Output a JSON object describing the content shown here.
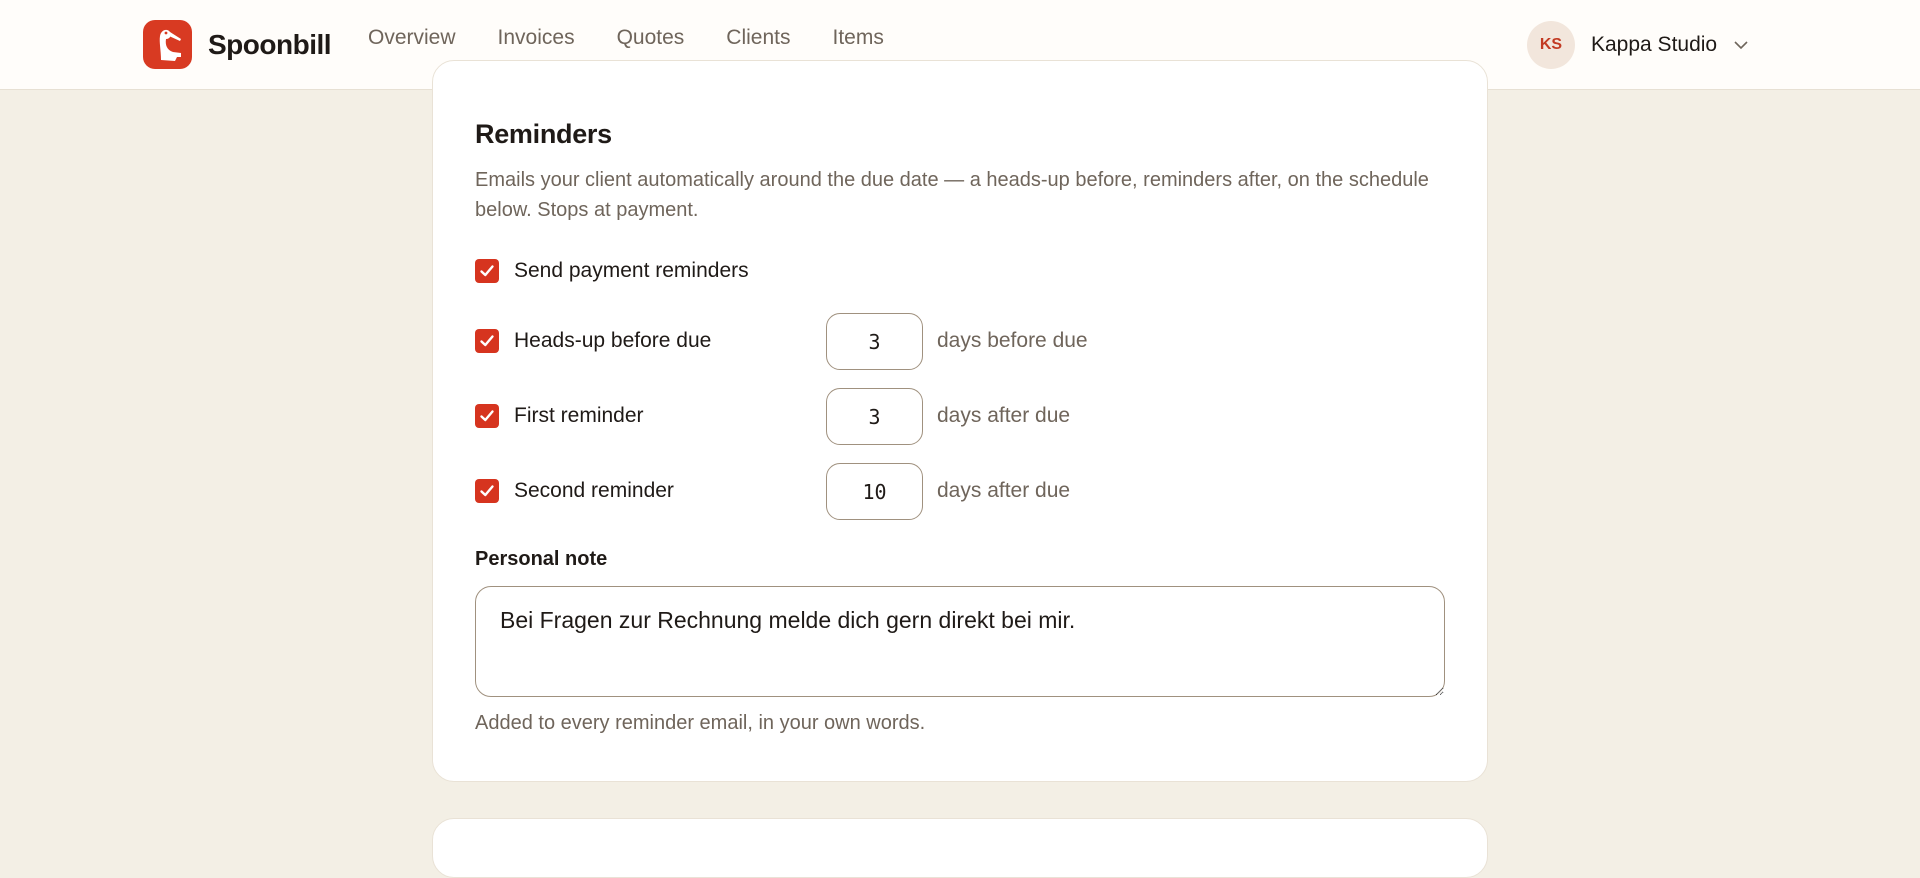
{
  "brand": {
    "name": "Spoonbill"
  },
  "nav": {
    "items": [
      {
        "label": "Overview"
      },
      {
        "label": "Invoices"
      },
      {
        "label": "Quotes"
      },
      {
        "label": "Clients"
      },
      {
        "label": "Items"
      }
    ]
  },
  "account": {
    "initials": "KS",
    "name": "Kappa Studio"
  },
  "reminders": {
    "title": "Reminders",
    "description": "Emails your client automatically around the due date — a heads-up before, reminders after, on the schedule below. Stops at payment.",
    "send_reminders": {
      "label": "Send payment reminders",
      "checked": true
    },
    "heads_up": {
      "label": "Heads-up before due",
      "checked": true,
      "value": "3",
      "unit": "days before due"
    },
    "first": {
      "label": "First reminder",
      "checked": true,
      "value": "3",
      "unit": "days after due"
    },
    "second": {
      "label": "Second reminder",
      "checked": true,
      "value": "10",
      "unit": "days after due"
    },
    "note": {
      "label": "Personal note",
      "value": "Bei Fragen zur Rechnung melde dich gern direkt bei mir.",
      "hint": "Added to every reminder email, in your own words."
    }
  },
  "colors": {
    "accent": "#d6341f",
    "background": "#f3efe5",
    "card": "#ffffff",
    "muted_text": "#6f655b"
  }
}
